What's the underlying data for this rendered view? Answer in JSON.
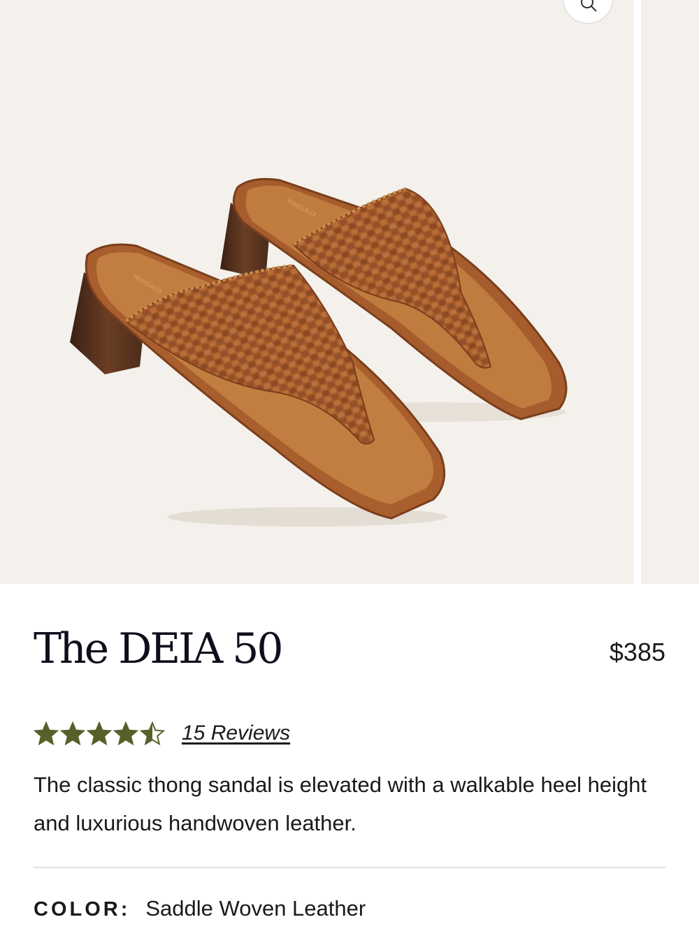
{
  "product": {
    "title": "The DEIA 50",
    "price": "$385",
    "rating": {
      "value": 4.5,
      "max": 5,
      "reviews_label": "15 Reviews"
    },
    "description": "The classic thong sandal is elevated with a walkable heel height and luxurious handwoven leather.",
    "color": {
      "label": "COLOR:",
      "value": "Saddle Woven Leather"
    }
  },
  "gallery": {
    "insole_brand": "MARGAUX",
    "zoom_icon": "search-icon"
  },
  "colors": {
    "star": "#56612a",
    "image_background": "#f4f1ec",
    "leather": "#a45a2a",
    "heel": "#4e2d1c"
  }
}
